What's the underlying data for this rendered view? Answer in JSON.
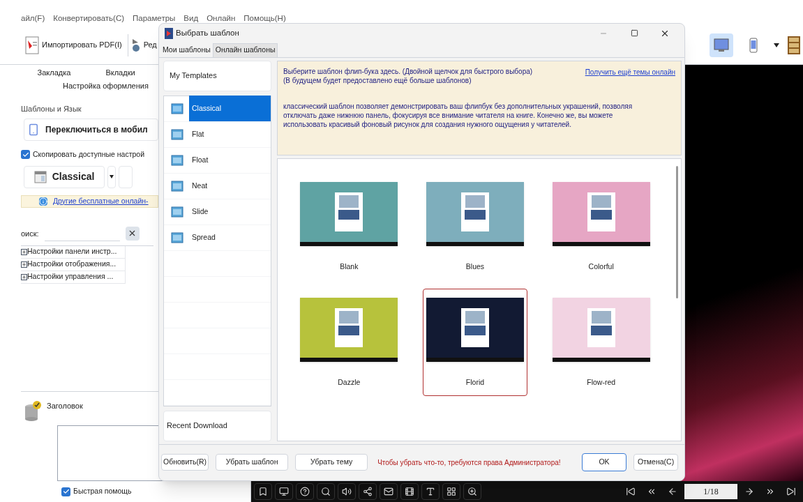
{
  "menu": [
    "айл(F)",
    "Конвертировать(C)",
    "Параметры",
    "Вид",
    "Онлайн",
    "Помощь(Н)"
  ],
  "toolbar": {
    "import_button": "Импортировать PDF(I)",
    "edit_button": "Ред"
  },
  "view_buttons": [
    {
      "kind": "desktop",
      "selected": true
    },
    {
      "kind": "phone",
      "selected": false
    }
  ],
  "left_panel": {
    "tabs": [
      "Закладка",
      "Вкладки"
    ],
    "subtitle": "Настройка оформления",
    "group_label": "Шаблоны и Язык",
    "mobile_switch": "Переключиться в мобил",
    "copy_settings": {
      "label": "Скопировать доступные настрой",
      "checked": true
    },
    "template_button": "Classical",
    "info_link": "Другие бесплатные онлайн-",
    "search_label": "оиск:",
    "tree": [
      {
        "label": "Настройки панели инстр...",
        "expanded": false
      },
      {
        "label": "Настройки отображения...",
        "expanded": false
      },
      {
        "label": "Настройки управления ...",
        "expanded": false
      }
    ],
    "caption_label": "Заголовок",
    "quick_help": {
      "label": "Быстрая помощь",
      "checked": true
    }
  },
  "preview": {
    "page_field": "1/18"
  },
  "dialog": {
    "title": "Выбрать шаблон",
    "tabs": [
      {
        "label": "Мои шаблоны",
        "selected": true
      },
      {
        "label": "Онлайн шаблоны",
        "selected": false
      }
    ],
    "my_templates_header": "My Templates",
    "categories": [
      {
        "label": "Classical",
        "selected": true
      },
      {
        "label": "Flat",
        "selected": false
      },
      {
        "label": "Float",
        "selected": false
      },
      {
        "label": "Neat",
        "selected": false
      },
      {
        "label": "Slide",
        "selected": false
      },
      {
        "label": "Spread",
        "selected": false
      }
    ],
    "recent_download": "Recent Download",
    "hint": "Выберите шаблон флип-бука здесь. (Двойной щелчок для быстрого выбора)\n(В будущем будет предоставлено ещё больше шаблонов)",
    "online_link": "Получить ещё темы онлайн",
    "description": "классический шаблон позволяет демонстрировать ваш флипбук без дополнительных украшений, позволяя отключать даже нижнюю панель, фокусируя все внимание читателя на книге. Конечно же, вы можете использовать красивый фоновый рисунок для создания нужного ощущения у читателей.",
    "templates": [
      {
        "name": "Blank",
        "color": "#5fa3a3",
        "selected": false
      },
      {
        "name": "Blues",
        "color": "#7eaebc",
        "selected": false
      },
      {
        "name": "Colorful",
        "color": "#e6a6c4",
        "selected": false
      },
      {
        "name": "Dazzle",
        "color": "#b7c23c",
        "selected": false
      },
      {
        "name": "Florid",
        "color": "#121a33",
        "selected": true
      },
      {
        "name": "Flow-red",
        "color": "#f2d3e2",
        "selected": false
      }
    ],
    "buttons": {
      "refresh": "Обновить(R)",
      "remove_template": "Убрать шаблон",
      "remove_theme": "Убрать тему",
      "ok": "OK",
      "cancel": "Отмена(C)"
    },
    "warning": "Чтобы убрать что-то, требуются права Администратора!"
  }
}
